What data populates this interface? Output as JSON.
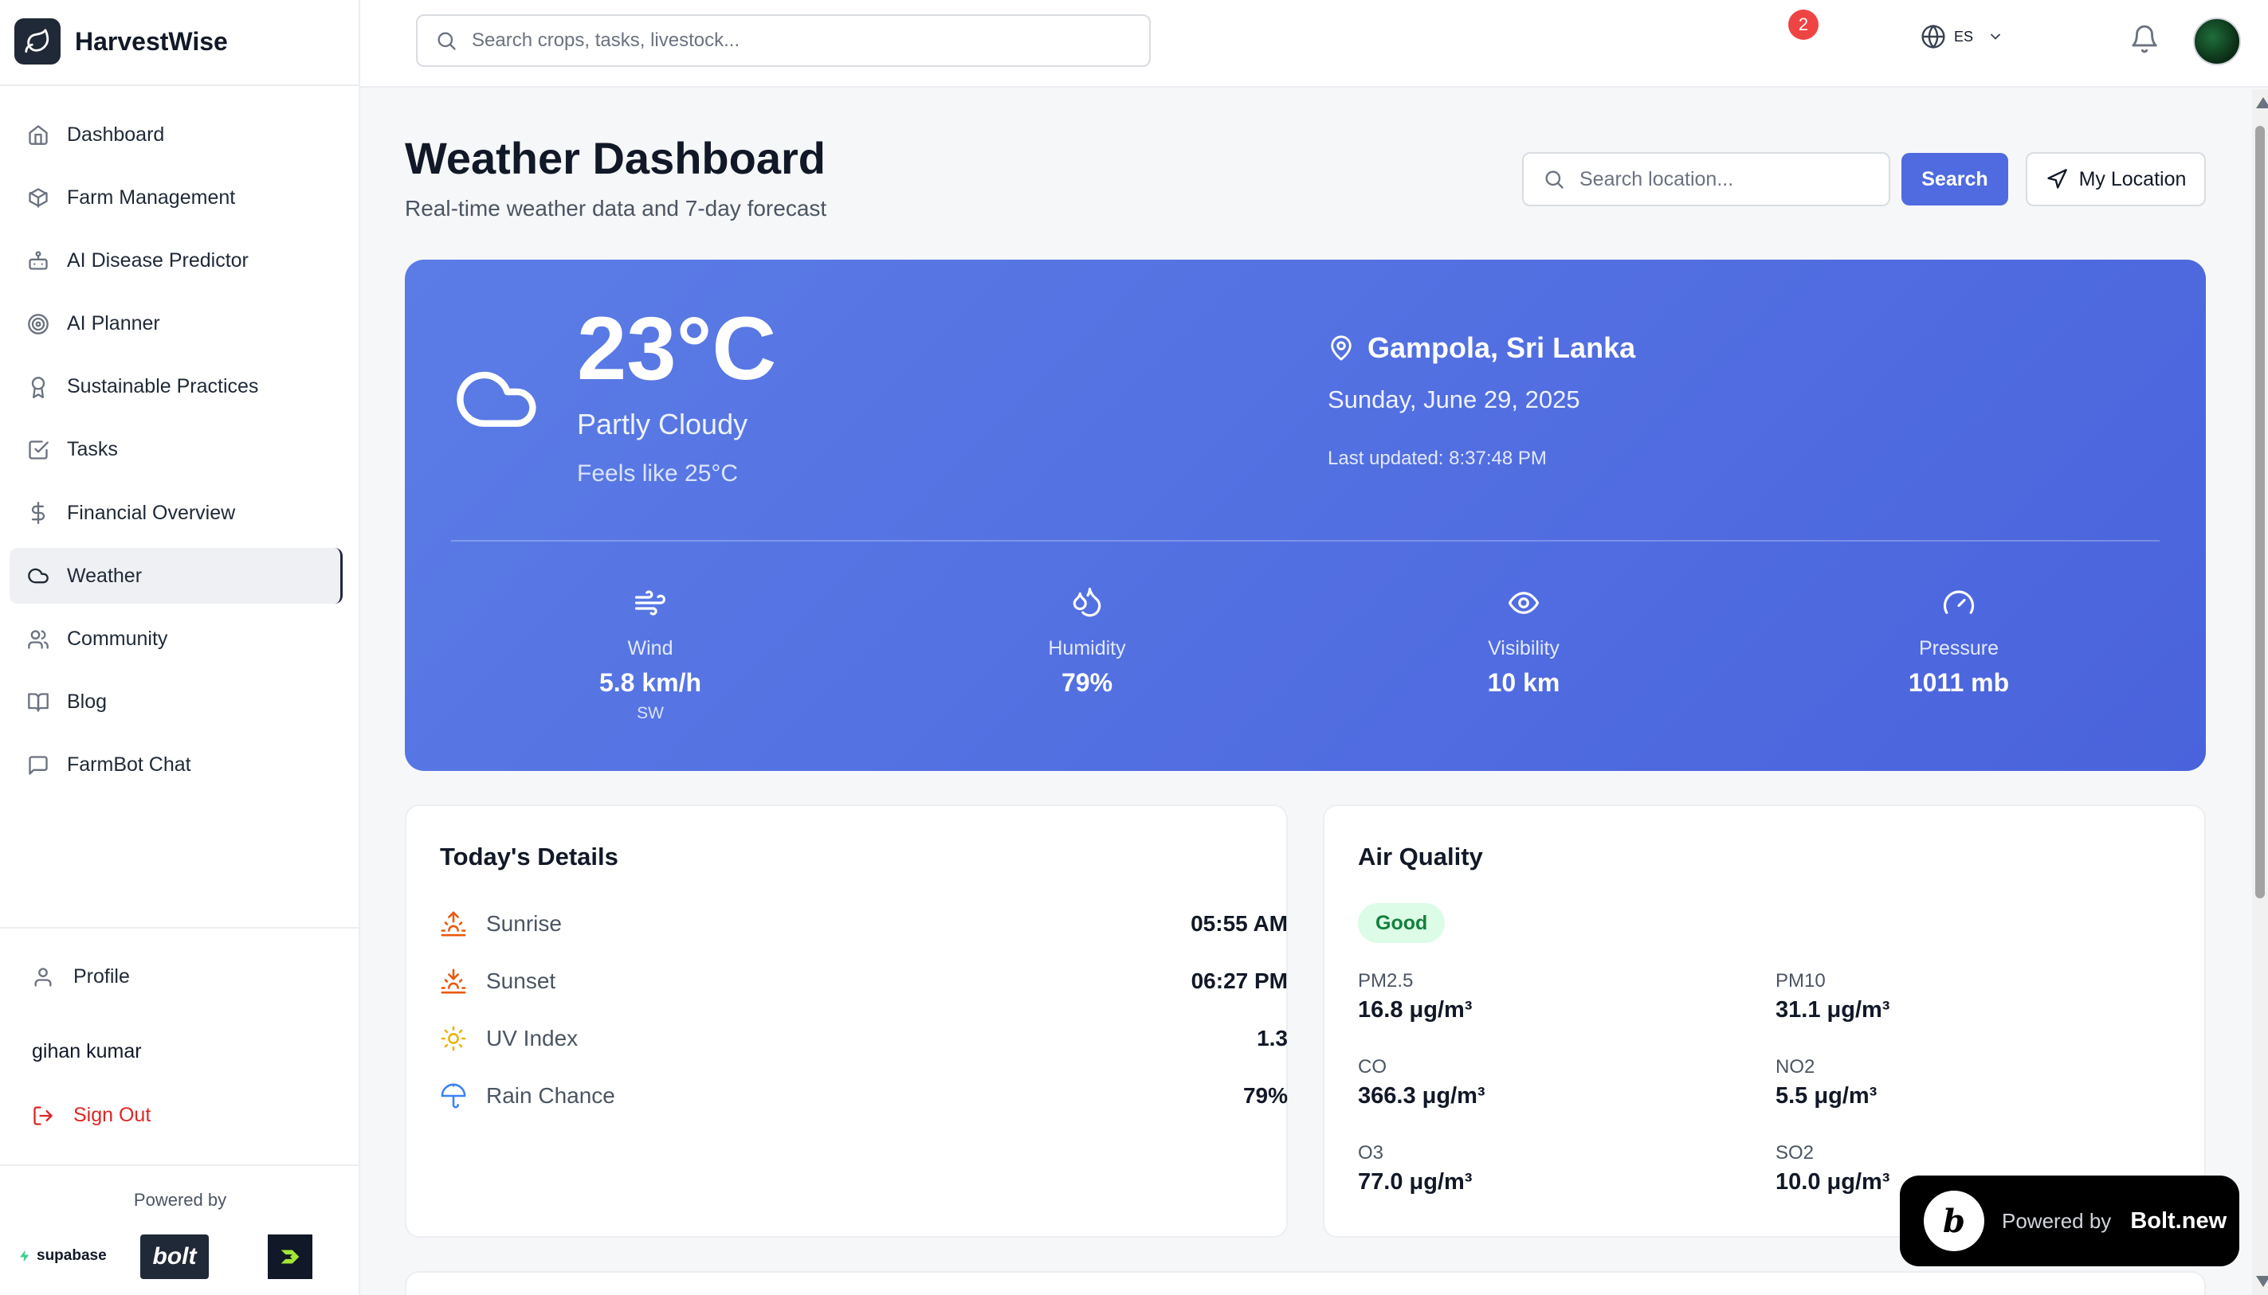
{
  "app": {
    "name": "HarvestWise"
  },
  "sidebar": {
    "items": [
      {
        "label": "Dashboard",
        "icon": "home-icon"
      },
      {
        "label": "Farm Management",
        "icon": "box-icon"
      },
      {
        "label": "AI Disease Predictor",
        "icon": "bot-icon"
      },
      {
        "label": "AI Planner",
        "icon": "target-icon"
      },
      {
        "label": "Sustainable Practices",
        "icon": "award-icon"
      },
      {
        "label": "Tasks",
        "icon": "check-square-icon"
      },
      {
        "label": "Financial Overview",
        "icon": "dollar-icon"
      },
      {
        "label": "Weather",
        "icon": "cloud-icon",
        "active": true
      },
      {
        "label": "Community",
        "icon": "users-icon"
      },
      {
        "label": "Blog",
        "icon": "book-icon"
      },
      {
        "label": "FarmBot Chat",
        "icon": "message-icon"
      }
    ],
    "profile_label": "Profile",
    "user_name": "gihan kumar",
    "signout_label": "Sign Out",
    "powered_by": "Powered by",
    "sponsors": {
      "supabase": "supabase",
      "bolt": "bolt"
    }
  },
  "topbar": {
    "search_placeholder": "Search crops, tasks, livestock...",
    "language": "ES",
    "notification_count": "2"
  },
  "page": {
    "title": "Weather Dashboard",
    "subtitle": "Real-time weather data and 7-day forecast",
    "location_placeholder": "Search location...",
    "search_button": "Search",
    "my_location_button": "My Location"
  },
  "current": {
    "temperature": "23°C",
    "condition": "Partly Cloudy",
    "feels_like": "Feels like 25°C",
    "location": "Gampola, Sri Lanka",
    "date": "Sunday, June 29, 2025",
    "last_updated": "Last updated: 8:37:48 PM",
    "stats": {
      "wind": {
        "label": "Wind",
        "value": "5.8 km/h",
        "sub": "SW"
      },
      "humidity": {
        "label": "Humidity",
        "value": "79%"
      },
      "visibility": {
        "label": "Visibility",
        "value": "10 km"
      },
      "pressure": {
        "label": "Pressure",
        "value": "1011 mb"
      }
    }
  },
  "today": {
    "title": "Today's Details",
    "rows": [
      {
        "label": "Sunrise",
        "value": "05:55 AM"
      },
      {
        "label": "Sunset",
        "value": "06:27 PM"
      },
      {
        "label": "UV Index",
        "value": "1.3"
      },
      {
        "label": "Rain Chance",
        "value": "79%"
      }
    ]
  },
  "air_quality": {
    "title": "Air Quality",
    "status": "Good",
    "items": [
      {
        "label": "PM2.5",
        "value": "16.8 μg/m³"
      },
      {
        "label": "PM10",
        "value": "31.1 μg/m³"
      },
      {
        "label": "CO",
        "value": "366.3 μg/m³"
      },
      {
        "label": "NO2",
        "value": "5.5 μg/m³"
      },
      {
        "label": "O3",
        "value": "77.0 μg/m³"
      },
      {
        "label": "SO2",
        "value": "10.0 μg/m³"
      }
    ]
  },
  "bolt_badge": {
    "powered": "Powered by",
    "name": "Bolt.new"
  },
  "colors": {
    "accent": "#4f6bdf",
    "hero_start": "#5b7ce6",
    "hero_end": "#4a63dc",
    "danger": "#dc2626",
    "good": "#15803d",
    "sun_orange": "#ea580c"
  }
}
